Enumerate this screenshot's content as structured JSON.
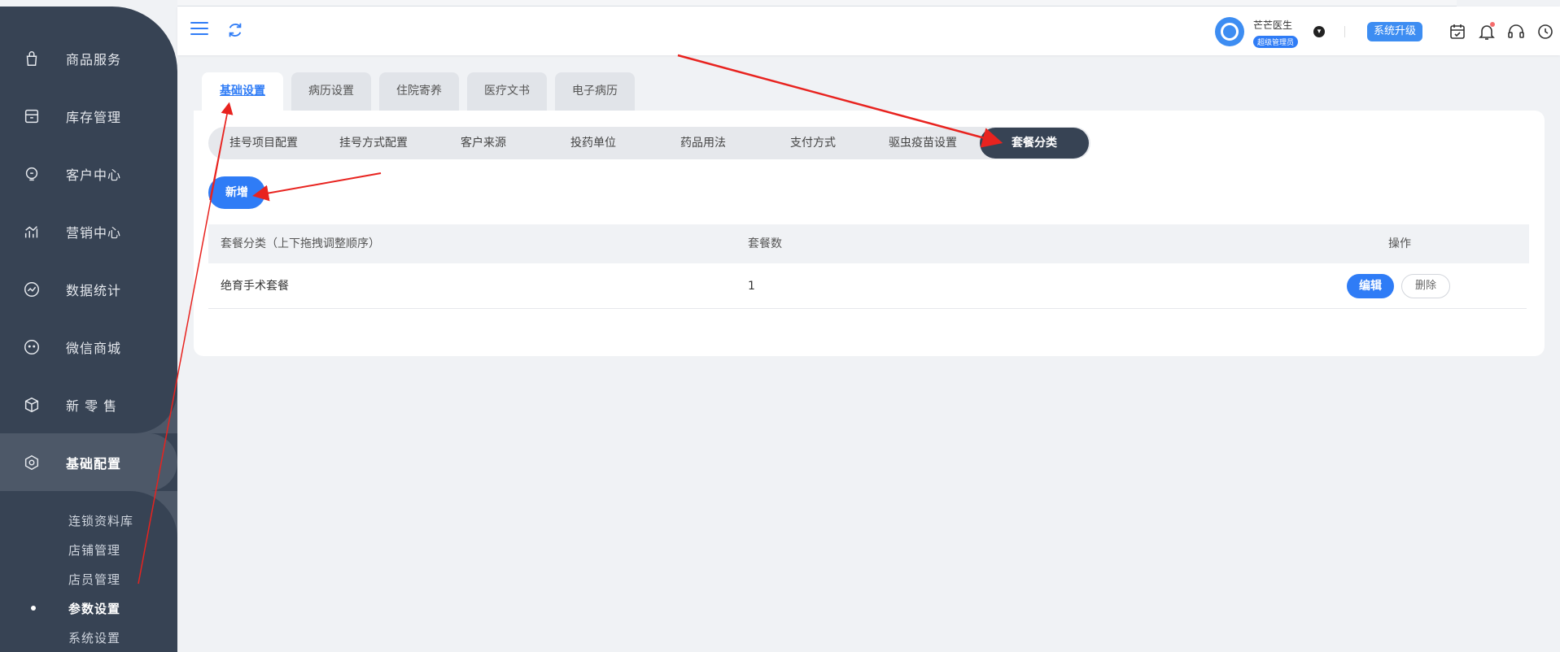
{
  "sidebar": {
    "items": [
      {
        "label": "商品服务",
        "icon": "bag-icon"
      },
      {
        "label": "库存管理",
        "icon": "inventory-icon"
      },
      {
        "label": "客户中心",
        "icon": "customer-icon"
      },
      {
        "label": "营销中心",
        "icon": "marketing-icon"
      },
      {
        "label": "数据统计",
        "icon": "stats-icon"
      },
      {
        "label": "微信商城",
        "icon": "wechat-icon"
      },
      {
        "label": "新 零 售",
        "icon": "retail-icon"
      },
      {
        "label": "基础配置",
        "icon": "config-icon"
      }
    ],
    "sub_items": [
      {
        "label": "连锁资料库"
      },
      {
        "label": "店铺管理"
      },
      {
        "label": "店员管理"
      },
      {
        "label": "参数设置"
      },
      {
        "label": "系统设置"
      }
    ]
  },
  "header": {
    "user_name": "芒芒医生",
    "user_role": "超级管理员",
    "upgrade_label": "系统升级"
  },
  "tabs": [
    {
      "label": "基础设置"
    },
    {
      "label": "病历设置"
    },
    {
      "label": "住院寄养"
    },
    {
      "label": "医疗文书"
    },
    {
      "label": "电子病历"
    }
  ],
  "subtabs": [
    {
      "label": "挂号项目配置"
    },
    {
      "label": "挂号方式配置"
    },
    {
      "label": "客户来源"
    },
    {
      "label": "投药单位"
    },
    {
      "label": "药品用法"
    },
    {
      "label": "支付方式"
    },
    {
      "label": "驱虫疫苗设置"
    },
    {
      "label": "套餐分类"
    }
  ],
  "actions": {
    "add_label": "新增"
  },
  "table": {
    "headers": [
      "套餐分类（上下拖拽调整顺序）",
      "套餐数",
      "操作"
    ],
    "rows": [
      {
        "name": "绝育手术套餐",
        "count": "1",
        "edit": "编辑",
        "delete": "删除"
      }
    ]
  },
  "colors": {
    "accent": "#2f7cf6",
    "sidebar": "#374354",
    "annotation": "#e8231f"
  }
}
